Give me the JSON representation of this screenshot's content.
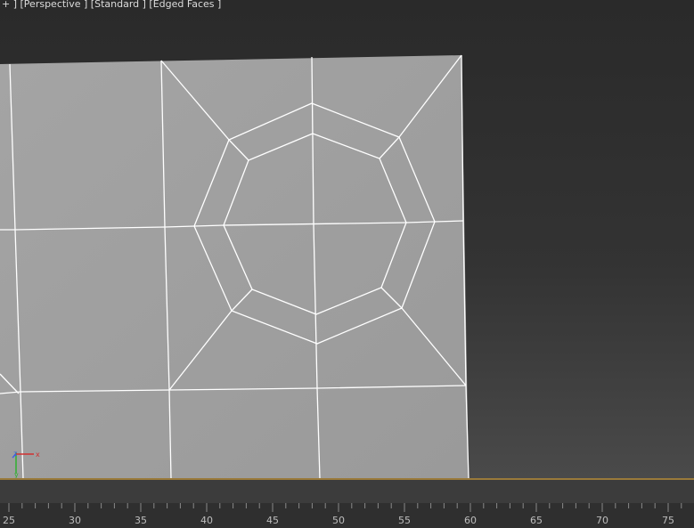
{
  "viewport": {
    "label_parts": [
      "+ ]",
      " [Perspective ]",
      " [Standard ]",
      " [Edged Faces ]"
    ]
  },
  "axis_gizmo": {
    "x": "x",
    "y": "y",
    "z": "z"
  },
  "time_ruler": {
    "labels": [
      "25",
      "30",
      "35",
      "40",
      "45",
      "50",
      "55",
      "60",
      "65",
      "70",
      "75"
    ]
  },
  "colors": {
    "mesh_face": "#a2a2a2",
    "mesh_edge": "#ffffff",
    "ground_line": "#9a7a3a",
    "axis_x": "#d03030",
    "axis_y": "#30b030",
    "axis_z": "#4060e0"
  }
}
